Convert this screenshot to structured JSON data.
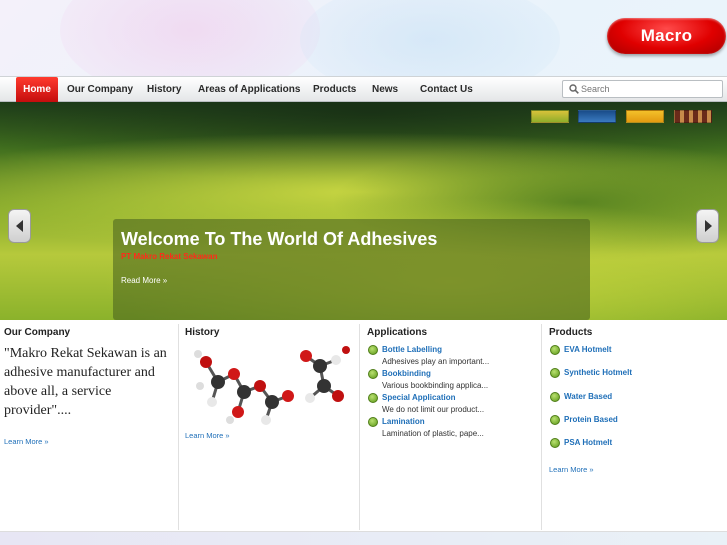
{
  "logo": {
    "text": "Macro"
  },
  "nav": {
    "items": [
      {
        "label": "Home"
      },
      {
        "label": "Our Company"
      },
      {
        "label": "History"
      },
      {
        "label": "Areas of Applications"
      },
      {
        "label": "Products"
      },
      {
        "label": "News"
      },
      {
        "label": "Contact Us"
      }
    ],
    "search_placeholder": "Search"
  },
  "hero": {
    "title": "Welcome To The World Of Adhesives",
    "subtitle": "PT Makro Rekat Sekawan",
    "read_more": "Read More »"
  },
  "company": {
    "title": "Our Company",
    "quote": "\"Makro Rekat Sekawan is an adhesive manufacturer and above all, a service provider\"....",
    "learn_more": "Learn More »"
  },
  "history": {
    "title": "History",
    "learn_more": "Learn More »"
  },
  "applications": {
    "title": "Applications",
    "items": [
      {
        "title": "Bottle Labelling",
        "desc": "Adhesives play an important..."
      },
      {
        "title": "Bookbinding",
        "desc": "Various bookbinding applica..."
      },
      {
        "title": "Special Application",
        "desc": "We do not limit our product..."
      },
      {
        "title": "Lamination",
        "desc": "Lamination of plastic, pape..."
      }
    ]
  },
  "products": {
    "title": "Products",
    "items": [
      {
        "title": "EVA Hotmelt"
      },
      {
        "title": "Synthetic Hotmelt"
      },
      {
        "title": "Water Based"
      },
      {
        "title": "Protein Based"
      },
      {
        "title": "PSA Hotmelt"
      }
    ],
    "learn_more": "Learn More »"
  },
  "colors": {
    "accent_red": "#e00000",
    "link_blue": "#1f6fb8",
    "bullet_green": "#5e9a1a"
  }
}
